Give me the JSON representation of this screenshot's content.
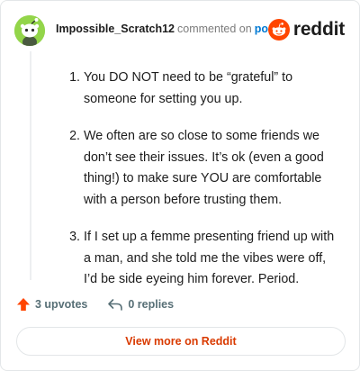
{
  "comment": {
    "username": "Impossible_Scratch12",
    "action_text": "commented on",
    "post_link": "post"
  },
  "brand": {
    "name": "reddit",
    "color": "#ff4500"
  },
  "body": {
    "items": [
      "You DO NOT need to be “grateful” to someone for setting you up.",
      "We often are so close to some friends we don’t see their issues. It’s ok (even a good thing!) to make sure YOU are comfortable with a person before trusting them.",
      "If I set up a femme presenting friend up with a man, and she told me the vibes were off, I’d be side eyeing him forever. Period."
    ]
  },
  "actions": {
    "upvotes": "3 upvotes",
    "replies": "0 replies",
    "upvote_icon": "upvote-arrow-icon",
    "reply_icon": "reply-arrow-icon"
  },
  "footer": {
    "view_more": "View more on Reddit"
  },
  "colors": {
    "avatar_bg": "#93d54a",
    "upvote": "#ff4500",
    "link": "#0079d3",
    "view_more": "#d93a00"
  }
}
